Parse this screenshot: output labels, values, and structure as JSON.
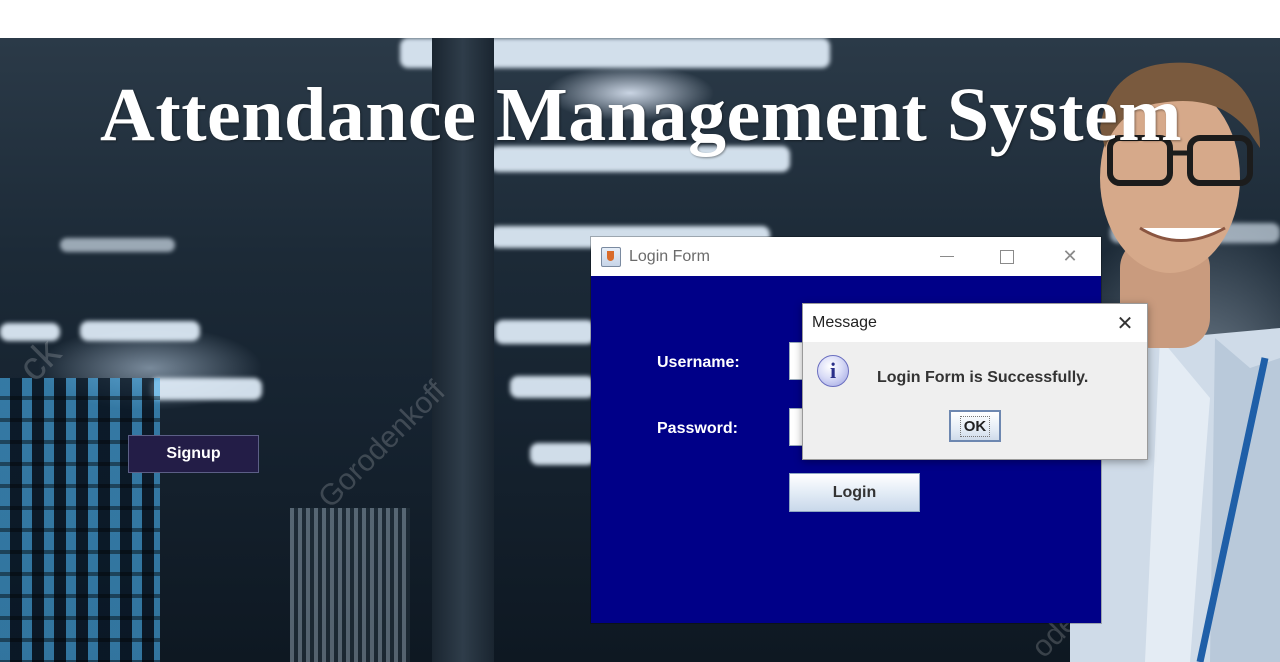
{
  "app": {
    "heading": "Attendance Management System",
    "signup_label": "Signup"
  },
  "background": {
    "watermark_text": "Gorodenkoff",
    "watermark_fragment": "ck",
    "watermark_fragment2": "ode"
  },
  "login_window": {
    "title": "Login Form",
    "minimize_icon": "minimize-icon",
    "maximize_icon": "maximize-icon",
    "close_glyph": "✕",
    "username_label": "Username:",
    "password_label": "Password:",
    "username_value": "",
    "password_value": "",
    "login_label": "Login",
    "body_color": "#000088"
  },
  "message_dialog": {
    "title": "Message",
    "close_glyph": "✕",
    "info_glyph": "i",
    "text": "Login Form is Successfully.",
    "ok_label": "OK"
  }
}
